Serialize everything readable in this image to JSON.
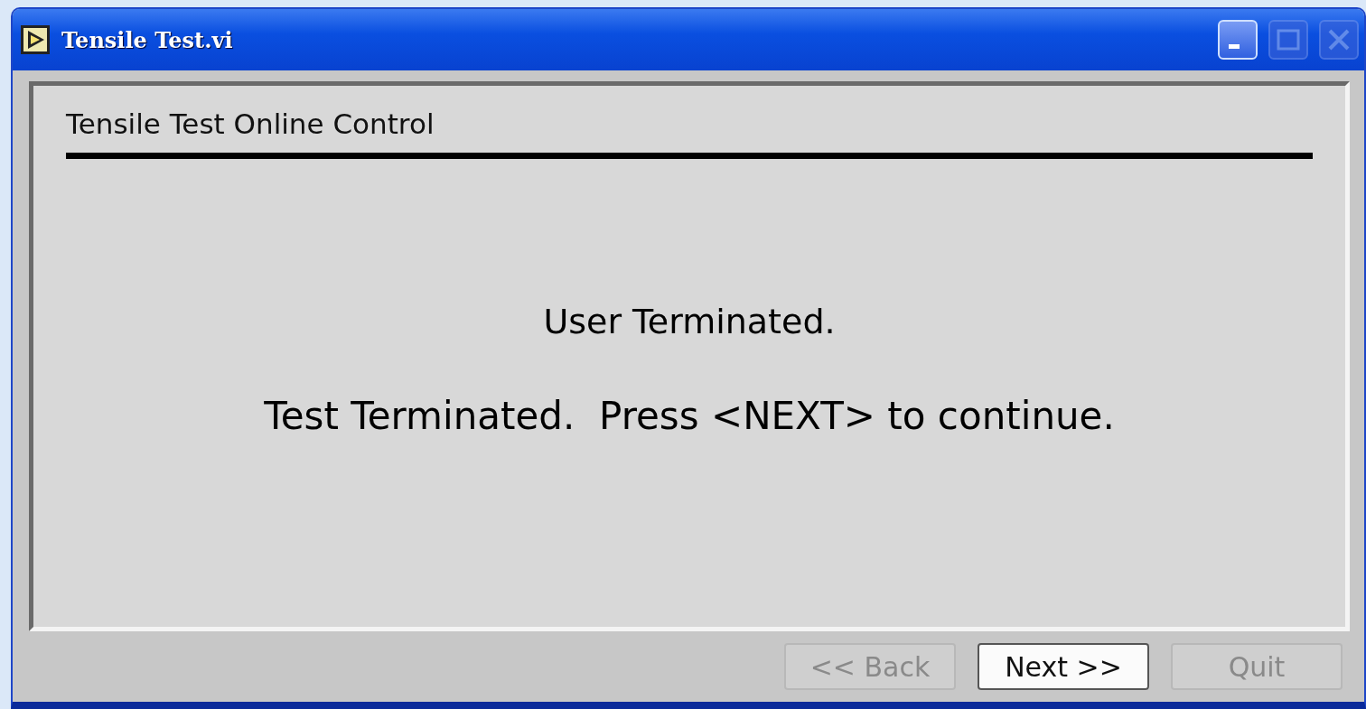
{
  "window": {
    "title": "Tensile Test.vi",
    "controls": [
      {
        "kind": "minimize",
        "disabled": false
      },
      {
        "kind": "maximize",
        "disabled": true
      },
      {
        "kind": "close",
        "disabled": true
      }
    ]
  },
  "panel": {
    "heading": "Tensile Test Online Control",
    "messages": [
      "User Terminated.",
      "Test Terminated.  Press <NEXT> to continue."
    ]
  },
  "buttons": [
    {
      "label": "<< Back",
      "disabled": true
    },
    {
      "label": "Next >>",
      "disabled": false
    },
    {
      "label": "Quit",
      "disabled": true
    }
  ]
}
